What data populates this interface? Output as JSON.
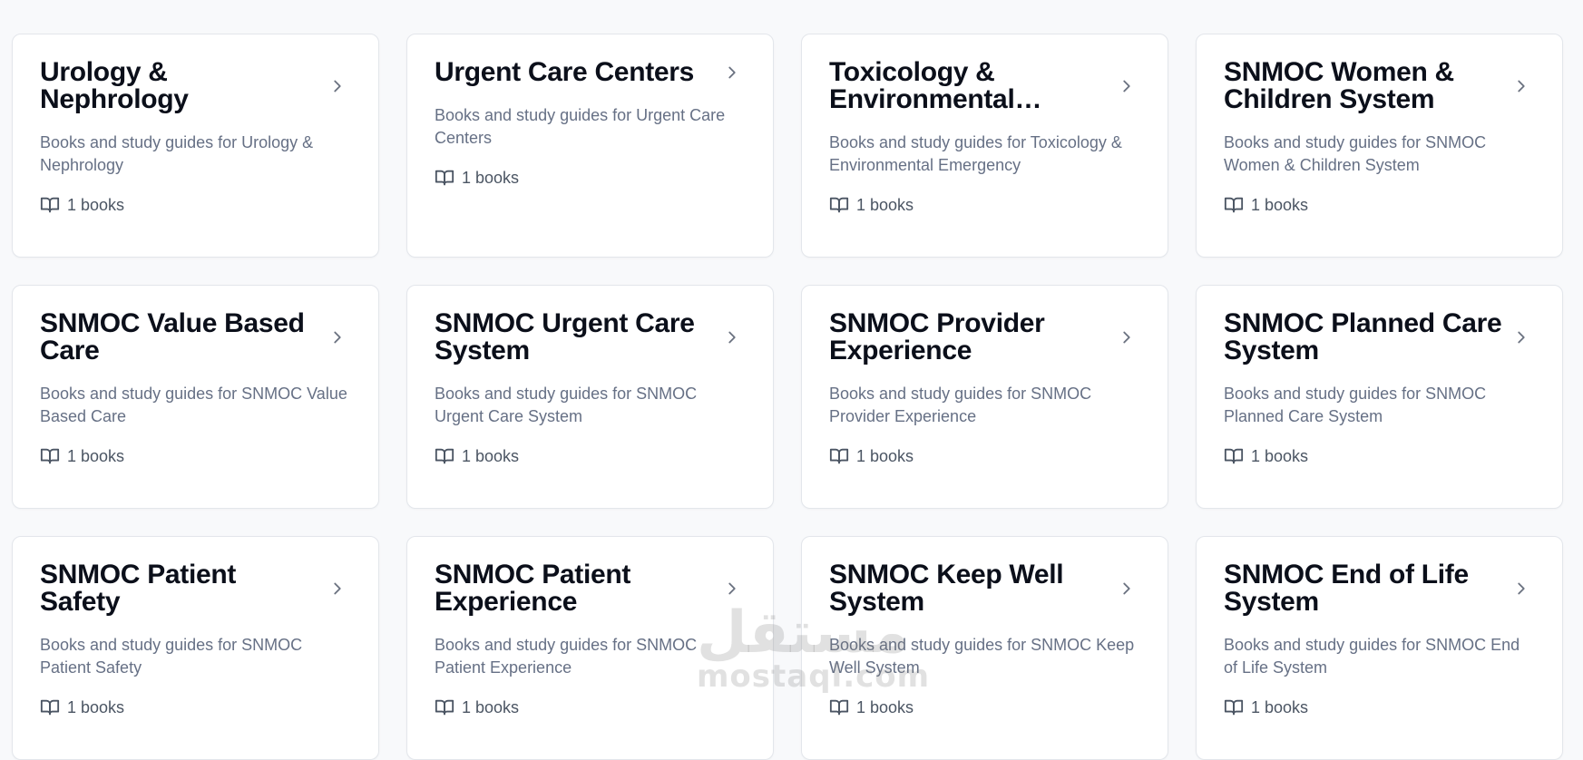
{
  "categories": [
    {
      "title": "Urology & Nephrology",
      "description": "Books and study guides for Urology & Nephrology",
      "count": "1 books"
    },
    {
      "title": "Urgent Care Centers",
      "description": "Books and study guides for Urgent Care Centers",
      "count": "1 books"
    },
    {
      "title": "Toxicology & Environmental Emergency",
      "description": "Books and study guides for Toxicology & Environmental Emergency",
      "count": "1 books"
    },
    {
      "title": "SNMOC Women & Children System",
      "description": "Books and study guides for SNMOC Women & Children System",
      "count": "1 books"
    },
    {
      "title": "SNMOC Value Based Care",
      "description": "Books and study guides for SNMOC Value Based Care",
      "count": "1 books"
    },
    {
      "title": "SNMOC Urgent Care System",
      "description": "Books and study guides for SNMOC Urgent Care System",
      "count": "1 books"
    },
    {
      "title": "SNMOC Provider Experience",
      "description": "Books and study guides for SNMOC Provider Experience",
      "count": "1 books"
    },
    {
      "title": "SNMOC Planned Care System",
      "description": "Books and study guides for SNMOC Planned Care System",
      "count": "1 books"
    },
    {
      "title": "SNMOC Patient Safety",
      "description": "Books and study guides for SNMOC Patient Safety",
      "count": "1 books"
    },
    {
      "title": "SNMOC Patient Experience",
      "description": "Books and study guides for SNMOC Patient Experience",
      "count": "1 books"
    },
    {
      "title": "SNMOC Keep Well System",
      "description": "Books and study guides for SNMOC Keep Well System",
      "count": "1 books"
    },
    {
      "title": "SNMOC End of Life System",
      "description": "Books and study guides for SNMOC End of Life System",
      "count": "1 books"
    }
  ],
  "icons": {
    "card_arrow": "chevron-right-icon",
    "count": "book-open-icon"
  },
  "colors": {
    "background": "#f8f9fb",
    "card": "#ffffff",
    "title": "#0b0f1a",
    "description": "#667085"
  },
  "watermark": {
    "arabic": "مستقل",
    "latin": "mostaql.com"
  }
}
